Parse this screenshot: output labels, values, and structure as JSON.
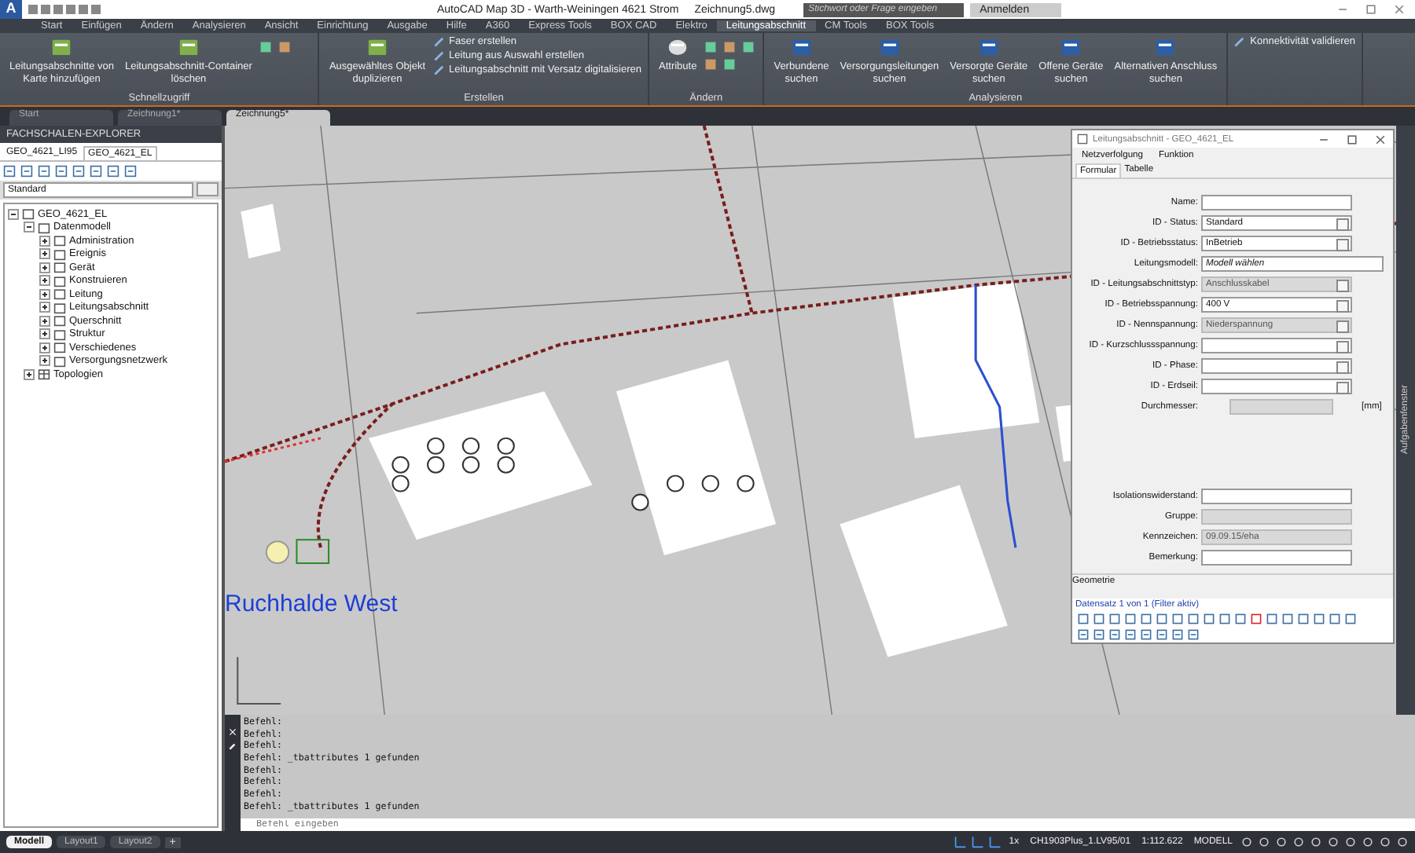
{
  "window": {
    "logo": "A",
    "title": "AutoCAD Map 3D - Warth-Weiningen 4621 Strom",
    "file": "Zeichnung5.dwg",
    "search": {
      "placeholder": "Stichwort oder Frage eingeben"
    },
    "login": "Anmelden"
  },
  "ribbon_tabs": [
    {
      "label": "Start",
      "selected": false
    },
    {
      "label": "Einfügen",
      "selected": false
    },
    {
      "label": "Ändern",
      "selected": false
    },
    {
      "label": "Analysieren",
      "selected": false
    },
    {
      "label": "Ansicht",
      "selected": false
    },
    {
      "label": "Einrichtung",
      "selected": false
    },
    {
      "label": "Ausgabe",
      "selected": false
    },
    {
      "label": "Hilfe",
      "selected": false
    },
    {
      "label": "A360",
      "selected": false
    },
    {
      "label": "Express Tools",
      "selected": false
    },
    {
      "label": "BOX CAD",
      "selected": false
    },
    {
      "label": "Elektro",
      "selected": false
    },
    {
      "label": "Leitungsabschnitt",
      "selected": true
    },
    {
      "label": "CM Tools",
      "selected": false
    },
    {
      "label": "BOX Tools",
      "selected": false
    }
  ],
  "ribbon_groups": [
    {
      "title": "Schnellzugriff",
      "large": [
        "Leitungsabschnitte von\nKarte hinzufügen",
        "Leitungsabschnitt-Container\nlöschen"
      ]
    },
    {
      "title": "Erstellen",
      "large": [
        "Ausgewähltes Objekt\nduplizieren"
      ],
      "small": [
        "Faser erstellen",
        "Leitung aus Auswahl erstellen",
        "Leitungsabschnitt mit Versatz digitalisieren"
      ]
    },
    {
      "title": "Ändern",
      "large": [
        "Attribute"
      ]
    },
    {
      "title": "Analysieren",
      "large": [
        "Verbundene\nsuchen",
        "Versorgungsleitungen\nsuchen",
        "Versorgte Geräte\nsuchen",
        "Offene Geräte\nsuchen",
        "Alternativen Anschluss\nsuchen"
      ]
    },
    {
      "small": [
        "Konnektivität validieren"
      ]
    }
  ],
  "doc_tabs": [
    {
      "label": "Start",
      "selected": false
    },
    {
      "label": "Zeichnung1*",
      "selected": false
    },
    {
      "label": "Zeichnung5*",
      "selected": true
    }
  ],
  "explorer": {
    "title": "FACHSCHALEN-EXPLORER",
    "tabs": [
      {
        "label": "GEO_4621_LI95",
        "selected": false
      },
      {
        "label": "GEO_4621_EL",
        "selected": true
      }
    ],
    "filter": "Standard",
    "tree": [
      {
        "label": "GEO_4621_EL",
        "expanded": true,
        "children": [
          {
            "label": "Datenmodell",
            "expanded": true,
            "children": [
              {
                "label": "Administration",
                "expanded": false
              },
              {
                "label": "Ereignis",
                "expanded": false
              },
              {
                "label": "Gerät",
                "expanded": false
              },
              {
                "label": "Konstruieren",
                "expanded": false
              },
              {
                "label": "Leitung",
                "expanded": false
              },
              {
                "label": "Leitungsabschnitt",
                "expanded": false
              },
              {
                "label": "Querschnitt",
                "expanded": false
              },
              {
                "label": "Struktur",
                "expanded": false
              },
              {
                "label": "Verschiedenes",
                "expanded": false
              },
              {
                "label": "Versorgungsnetzwerk",
                "expanded": false
              }
            ]
          },
          {
            "label": "Topologien",
            "expanded": false
          }
        ]
      }
    ]
  },
  "map": {
    "label": "Ruchhalde West"
  },
  "dialog": {
    "title": "Leitungsabschnitt - GEO_4621_EL",
    "menu": [
      "Netzverfolgung",
      "Funktion"
    ],
    "tabs": [
      {
        "label": "Formular",
        "selected": true
      },
      {
        "label": "Tabelle",
        "selected": false
      }
    ],
    "fields": [
      {
        "label": "Name:",
        "kind": "text",
        "disabled": false
      },
      {
        "label": "ID - Status:",
        "kind": "select",
        "value": "Standard",
        "disabled": false
      },
      {
        "label": "ID - Betriebsstatus:",
        "kind": "select",
        "value": "InBetrieb",
        "disabled": false
      },
      {
        "label": "Leitungsmodell:",
        "kind": "picker",
        "value": "Modell wählen",
        "disabled": false
      },
      {
        "label": "ID - Leitungsabschnittstyp:",
        "kind": "select",
        "value": "Anschlusskabel",
        "disabled": true
      },
      {
        "label": "ID - Betriebsspannung:",
        "kind": "select",
        "value": "400 V",
        "disabled": false
      },
      {
        "label": "ID - Nennspannung:",
        "kind": "select",
        "value": "Niederspannung",
        "disabled": true
      },
      {
        "label": "ID - Kurzschlussspannung:",
        "kind": "select",
        "disabled": false
      },
      {
        "label": "ID - Phase:",
        "kind": "select",
        "disabled": false
      },
      {
        "label": "ID - Erdseil:",
        "kind": "select",
        "disabled": false
      },
      {
        "label": "Durchmesser:",
        "kind": "unit",
        "unit": "[mm]",
        "disabled": true
      },
      {
        "kind": "gap"
      },
      {
        "label": "Isolationswiderstand:",
        "kind": "text",
        "disabled": false
      },
      {
        "label": "Gruppe:",
        "kind": "text",
        "disabled": true
      },
      {
        "label": "Kennzeichen:",
        "kind": "text",
        "value": "09.09.15/eha",
        "disabled": true
      },
      {
        "label": "Bemerkung:",
        "kind": "text",
        "disabled": false
      }
    ],
    "section": "Geometrie",
    "record": "Datensatz 1 von 1 (Filter aktiv)"
  },
  "side_panel": "Aufgabenfenster",
  "command": {
    "lines": [
      "Befehl:",
      "Befehl:",
      "Befehl:",
      "Befehl: _tbattributes 1 gefunden",
      "Befehl:",
      "Befehl:",
      "Befehl:",
      "Befehl: _tbattributes 1 gefunden"
    ],
    "placeholder": "Befehl eingeben"
  },
  "status_bar": {
    "layouts": [
      {
        "label": "Modell",
        "selected": true
      },
      {
        "label": "Layout1",
        "selected": false
      },
      {
        "label": "Layout2",
        "selected": false
      }
    ],
    "add": "+",
    "items": [
      "1x",
      "CH1903Plus_1.LV95/01",
      "1:112.622",
      "MODELL"
    ]
  }
}
